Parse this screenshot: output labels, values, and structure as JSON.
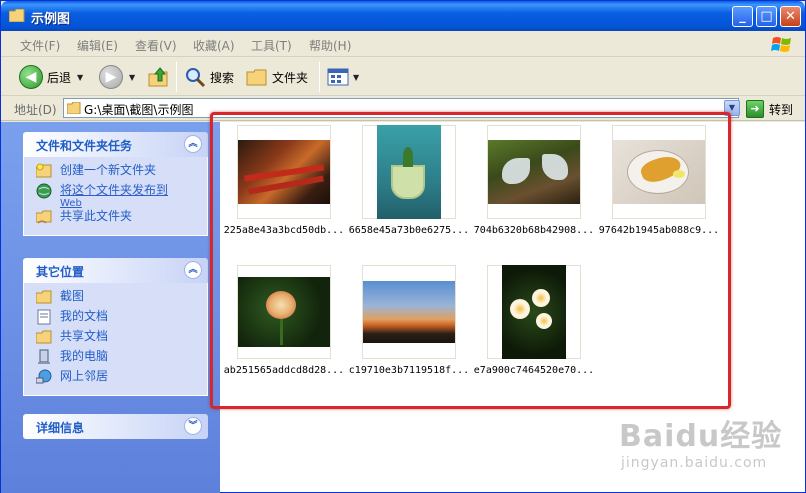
{
  "window": {
    "title": "示例图"
  },
  "menu": [
    "文件(F)",
    "编辑(E)",
    "查看(V)",
    "收藏(A)",
    "工具(T)",
    "帮助(H)"
  ],
  "toolbar": {
    "back": "后退",
    "search": "搜索",
    "folders": "文件夹"
  },
  "address": {
    "label": "地址(D)",
    "path": "G:\\桌面\\截图\\示例图",
    "go": "转到"
  },
  "tasks_panel": {
    "title": "文件和文件夹任务",
    "items": [
      {
        "label": "创建一个新文件夹",
        "icon": "new-folder-icon"
      },
      {
        "label": "将这个文件夹发布到",
        "label2": "Web",
        "icon": "publish-web-icon"
      },
      {
        "label": "共享此文件夹",
        "icon": "share-folder-icon"
      }
    ]
  },
  "places_panel": {
    "title": "其它位置",
    "items": [
      {
        "label": "截图",
        "icon": "folder-icon"
      },
      {
        "label": "我的文档",
        "icon": "my-documents-icon"
      },
      {
        "label": "共享文档",
        "icon": "shared-documents-icon"
      },
      {
        "label": "我的电脑",
        "icon": "my-computer-icon"
      },
      {
        "label": "网上邻居",
        "icon": "network-places-icon"
      }
    ]
  },
  "details_panel": {
    "title": "详细信息"
  },
  "files": [
    {
      "name": "225a8e43a3bcd50db..."
    },
    {
      "name": "6658e45a73b0e6275..."
    },
    {
      "name": "704b6320b68b42908..."
    },
    {
      "name": "97642b1945ab088c9..."
    },
    {
      "name": "ab251565addcd8d28..."
    },
    {
      "name": "c19710e3b7119518f..."
    },
    {
      "name": "e7a900c7464520e70..."
    }
  ],
  "watermark": {
    "main": "Baidu经验",
    "sub": "jingyan.baidu.com"
  }
}
